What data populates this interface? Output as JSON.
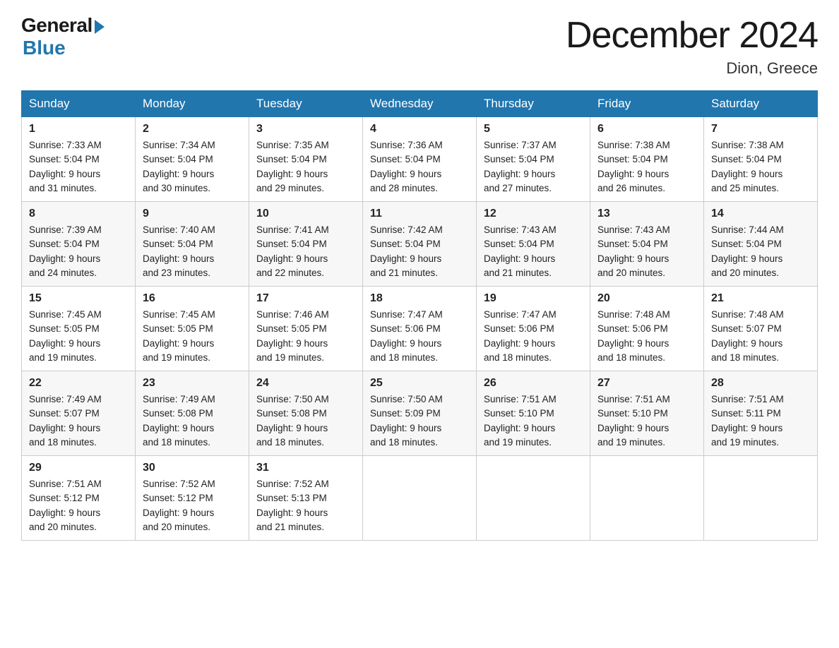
{
  "logo": {
    "general": "General",
    "blue": "Blue"
  },
  "title": "December 2024",
  "location": "Dion, Greece",
  "days_of_week": [
    "Sunday",
    "Monday",
    "Tuesday",
    "Wednesday",
    "Thursday",
    "Friday",
    "Saturday"
  ],
  "weeks": [
    [
      {
        "day": "1",
        "sunrise": "7:33 AM",
        "sunset": "5:04 PM",
        "daylight": "9 hours and 31 minutes."
      },
      {
        "day": "2",
        "sunrise": "7:34 AM",
        "sunset": "5:04 PM",
        "daylight": "9 hours and 30 minutes."
      },
      {
        "day": "3",
        "sunrise": "7:35 AM",
        "sunset": "5:04 PM",
        "daylight": "9 hours and 29 minutes."
      },
      {
        "day": "4",
        "sunrise": "7:36 AM",
        "sunset": "5:04 PM",
        "daylight": "9 hours and 28 minutes."
      },
      {
        "day": "5",
        "sunrise": "7:37 AM",
        "sunset": "5:04 PM",
        "daylight": "9 hours and 27 minutes."
      },
      {
        "day": "6",
        "sunrise": "7:38 AM",
        "sunset": "5:04 PM",
        "daylight": "9 hours and 26 minutes."
      },
      {
        "day": "7",
        "sunrise": "7:38 AM",
        "sunset": "5:04 PM",
        "daylight": "9 hours and 25 minutes."
      }
    ],
    [
      {
        "day": "8",
        "sunrise": "7:39 AM",
        "sunset": "5:04 PM",
        "daylight": "9 hours and 24 minutes."
      },
      {
        "day": "9",
        "sunrise": "7:40 AM",
        "sunset": "5:04 PM",
        "daylight": "9 hours and 23 minutes."
      },
      {
        "day": "10",
        "sunrise": "7:41 AM",
        "sunset": "5:04 PM",
        "daylight": "9 hours and 22 minutes."
      },
      {
        "day": "11",
        "sunrise": "7:42 AM",
        "sunset": "5:04 PM",
        "daylight": "9 hours and 21 minutes."
      },
      {
        "day": "12",
        "sunrise": "7:43 AM",
        "sunset": "5:04 PM",
        "daylight": "9 hours and 21 minutes."
      },
      {
        "day": "13",
        "sunrise": "7:43 AM",
        "sunset": "5:04 PM",
        "daylight": "9 hours and 20 minutes."
      },
      {
        "day": "14",
        "sunrise": "7:44 AM",
        "sunset": "5:04 PM",
        "daylight": "9 hours and 20 minutes."
      }
    ],
    [
      {
        "day": "15",
        "sunrise": "7:45 AM",
        "sunset": "5:05 PM",
        "daylight": "9 hours and 19 minutes."
      },
      {
        "day": "16",
        "sunrise": "7:45 AM",
        "sunset": "5:05 PM",
        "daylight": "9 hours and 19 minutes."
      },
      {
        "day": "17",
        "sunrise": "7:46 AM",
        "sunset": "5:05 PM",
        "daylight": "9 hours and 19 minutes."
      },
      {
        "day": "18",
        "sunrise": "7:47 AM",
        "sunset": "5:06 PM",
        "daylight": "9 hours and 18 minutes."
      },
      {
        "day": "19",
        "sunrise": "7:47 AM",
        "sunset": "5:06 PM",
        "daylight": "9 hours and 18 minutes."
      },
      {
        "day": "20",
        "sunrise": "7:48 AM",
        "sunset": "5:06 PM",
        "daylight": "9 hours and 18 minutes."
      },
      {
        "day": "21",
        "sunrise": "7:48 AM",
        "sunset": "5:07 PM",
        "daylight": "9 hours and 18 minutes."
      }
    ],
    [
      {
        "day": "22",
        "sunrise": "7:49 AM",
        "sunset": "5:07 PM",
        "daylight": "9 hours and 18 minutes."
      },
      {
        "day": "23",
        "sunrise": "7:49 AM",
        "sunset": "5:08 PM",
        "daylight": "9 hours and 18 minutes."
      },
      {
        "day": "24",
        "sunrise": "7:50 AM",
        "sunset": "5:08 PM",
        "daylight": "9 hours and 18 minutes."
      },
      {
        "day": "25",
        "sunrise": "7:50 AM",
        "sunset": "5:09 PM",
        "daylight": "9 hours and 18 minutes."
      },
      {
        "day": "26",
        "sunrise": "7:51 AM",
        "sunset": "5:10 PM",
        "daylight": "9 hours and 19 minutes."
      },
      {
        "day": "27",
        "sunrise": "7:51 AM",
        "sunset": "5:10 PM",
        "daylight": "9 hours and 19 minutes."
      },
      {
        "day": "28",
        "sunrise": "7:51 AM",
        "sunset": "5:11 PM",
        "daylight": "9 hours and 19 minutes."
      }
    ],
    [
      {
        "day": "29",
        "sunrise": "7:51 AM",
        "sunset": "5:12 PM",
        "daylight": "9 hours and 20 minutes."
      },
      {
        "day": "30",
        "sunrise": "7:52 AM",
        "sunset": "5:12 PM",
        "daylight": "9 hours and 20 minutes."
      },
      {
        "day": "31",
        "sunrise": "7:52 AM",
        "sunset": "5:13 PM",
        "daylight": "9 hours and 21 minutes."
      },
      null,
      null,
      null,
      null
    ]
  ],
  "labels": {
    "sunrise_prefix": "Sunrise: ",
    "sunset_prefix": "Sunset: ",
    "daylight_prefix": "Daylight: "
  }
}
